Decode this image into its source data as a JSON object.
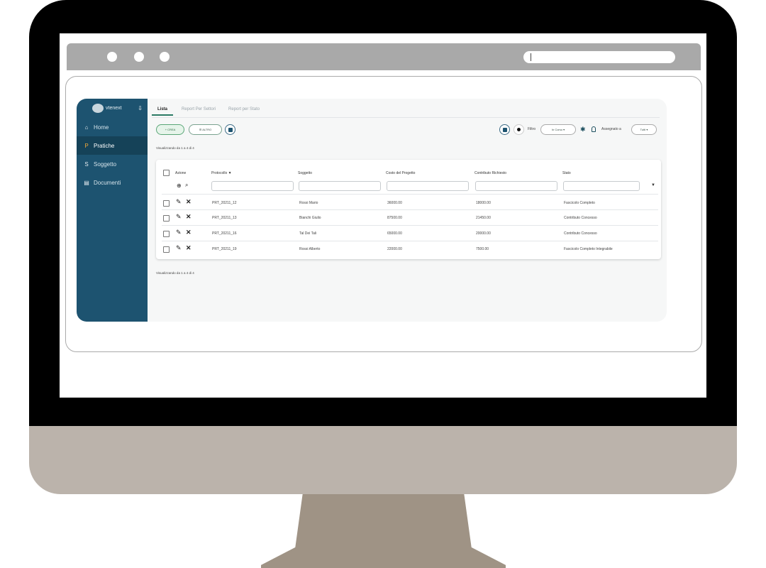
{
  "browser": {
    "address": ""
  },
  "sidebar": {
    "brand": "vtenext",
    "items": [
      {
        "icon": "home-icon",
        "label": "Home",
        "glyph": "⌂"
      },
      {
        "icon": "pratiche-icon",
        "label": "Pratiche",
        "glyph": "P"
      },
      {
        "icon": "soggetto-icon",
        "label": "Soggetto",
        "glyph": "S"
      },
      {
        "icon": "document-icon",
        "label": "Documenti",
        "glyph": "▤"
      }
    ]
  },
  "tabs": [
    "Lista",
    "Report Per Settori",
    "Report per Stato"
  ],
  "toolbar": {
    "create_label": "+ CREA",
    "other_label": "☰ ALTRO",
    "filter_label": "Filtro",
    "filter_value": "In Corso ▾",
    "assigned_label": "Assegnato a",
    "assigned_value": "Tutti ▾"
  },
  "info_top": "Visualizzando da 1 a 4 di 4",
  "info_bottom": "Visualizzando da 1 a 4 di 4",
  "table": {
    "headers": {
      "azione": "Azione",
      "protocollo": "Protocollo ▼",
      "soggetto": "Soggetto",
      "costo": "Costo del Progetto",
      "contributo": "Contributo Richiesto",
      "stato": "Stato"
    },
    "rows": [
      {
        "protocollo": "PRT_20211_12",
        "soggetto": "Rossi Mario",
        "costo": "36000.00",
        "contributo": "18000.00",
        "stato": "Fascicolo Completo"
      },
      {
        "protocollo": "PRT_20211_13",
        "soggetto": "Bianchi Giulio",
        "costo": "87500.00",
        "contributo": "21450.00",
        "stato": "Contributo Concesso"
      },
      {
        "protocollo": "PRT_20211_16",
        "soggetto": "Tal Dei Tali",
        "costo": "65000.00",
        "contributo": "20000.00",
        "stato": "Contributo Concesso"
      },
      {
        "protocollo": "PRT_20211_19",
        "soggetto": "Rossi Alberto",
        "costo": "22000.00",
        "contributo": "7500.00",
        "stato": "Fascicolo Completo Integrabile"
      }
    ]
  },
  "colors": {
    "sidebar": "#1d5370",
    "accent": "#2b7a64",
    "highlight": "#f0a93a"
  }
}
